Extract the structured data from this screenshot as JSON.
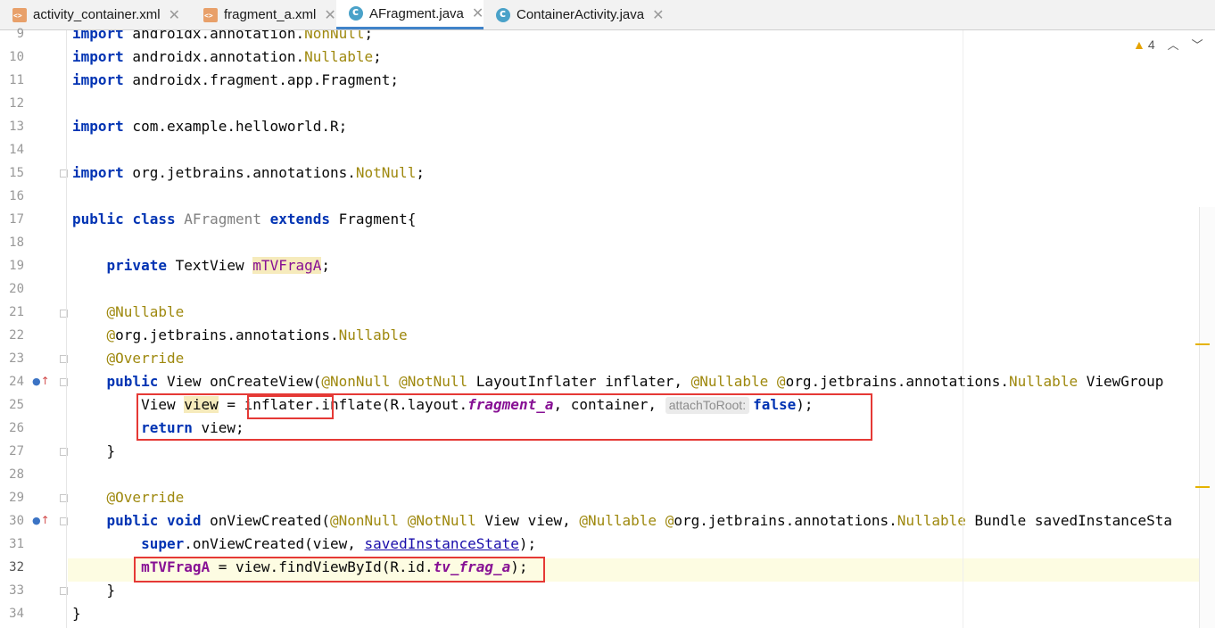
{
  "tabs": [
    {
      "label": "activity_container.xml",
      "type": "xml",
      "active": false
    },
    {
      "label": "fragment_a.xml",
      "type": "xml",
      "active": false
    },
    {
      "label": "AFragment.java",
      "type": "java",
      "active": true
    },
    {
      "label": "ContainerActivity.java",
      "type": "java",
      "active": false
    }
  ],
  "inspection": {
    "warning_count": "4"
  },
  "line_numbers": [
    "9",
    "10",
    "11",
    "12",
    "13",
    "14",
    "15",
    "16",
    "17",
    "18",
    "19",
    "20",
    "21",
    "22",
    "23",
    "24",
    "25",
    "26",
    "27",
    "28",
    "29",
    "30",
    "31",
    "32",
    "33",
    "34"
  ],
  "code": {
    "l9": [
      "import",
      " androidx.annotation.",
      "NonNull",
      ";"
    ],
    "l10": [
      "import",
      " androidx.annotation.",
      "Nullable",
      ";"
    ],
    "l11": [
      "import",
      " androidx.fragment.app.Fragment;"
    ],
    "l13": [
      "import",
      " com.example.helloworld.R;"
    ],
    "l15": [
      "import",
      " org.jetbrains.annotations.",
      "NotNull",
      ";"
    ],
    "l17": [
      "public",
      " ",
      "class",
      " ",
      "AFragment",
      " ",
      "extends",
      " Fragment{"
    ],
    "l19": [
      "    ",
      "private",
      " TextView ",
      "mTVFragA",
      ";"
    ],
    "l21": [
      "    ",
      "@Nullable"
    ],
    "l22": [
      "    ",
      "@",
      "org.jetbrains.annotations.",
      "Nullable"
    ],
    "l23": [
      "    ",
      "@Override"
    ],
    "l24": [
      "    ",
      "public",
      " View onCreateView(",
      "@NonNull",
      " ",
      "@NotNull",
      " LayoutInflater inflater, ",
      "@Nullable",
      " ",
      "@",
      "org.jetbrains.annotations.",
      "Nullable",
      " ViewGroup"
    ],
    "l25": [
      "        View ",
      "view",
      " = ",
      "inflater.",
      "inflate(R.layout.",
      "fragment_a",
      ", container, ",
      "attachToRoot:",
      " ",
      "false",
      ");"
    ],
    "l26": [
      "        ",
      "return",
      " view;"
    ],
    "l27": [
      "    }"
    ],
    "l29": [
      "    ",
      "@Override"
    ],
    "l30": [
      "    ",
      "public",
      " ",
      "void",
      " onViewCreated(",
      "@NonNull",
      " ",
      "@NotNull",
      " View view, ",
      "@Nullable",
      " ",
      "@",
      "org.jetbrains.annotations.",
      "Nullable",
      " Bundle savedInstanceSta"
    ],
    "l31": [
      "        ",
      "super",
      ".onViewCreated(view, ",
      "savedInstanceState",
      ");"
    ],
    "l32": [
      "        ",
      "mTVFragA",
      " = view.findViewById(R.id.",
      "tv_frag_a",
      ");"
    ],
    "l33": [
      "    }"
    ],
    "l34": [
      "}"
    ]
  },
  "colors": {
    "keyword": "#0033b3",
    "annotation": "#9e880d",
    "field": "#871094",
    "highlight_box": "#e53935",
    "tab_active_underline": "#4083c9"
  },
  "icons": {
    "xml_tab": "xml-file-icon",
    "java_tab": "java-class-icon",
    "close": "close-icon",
    "warning": "warning-icon",
    "override": "override-method-icon"
  }
}
